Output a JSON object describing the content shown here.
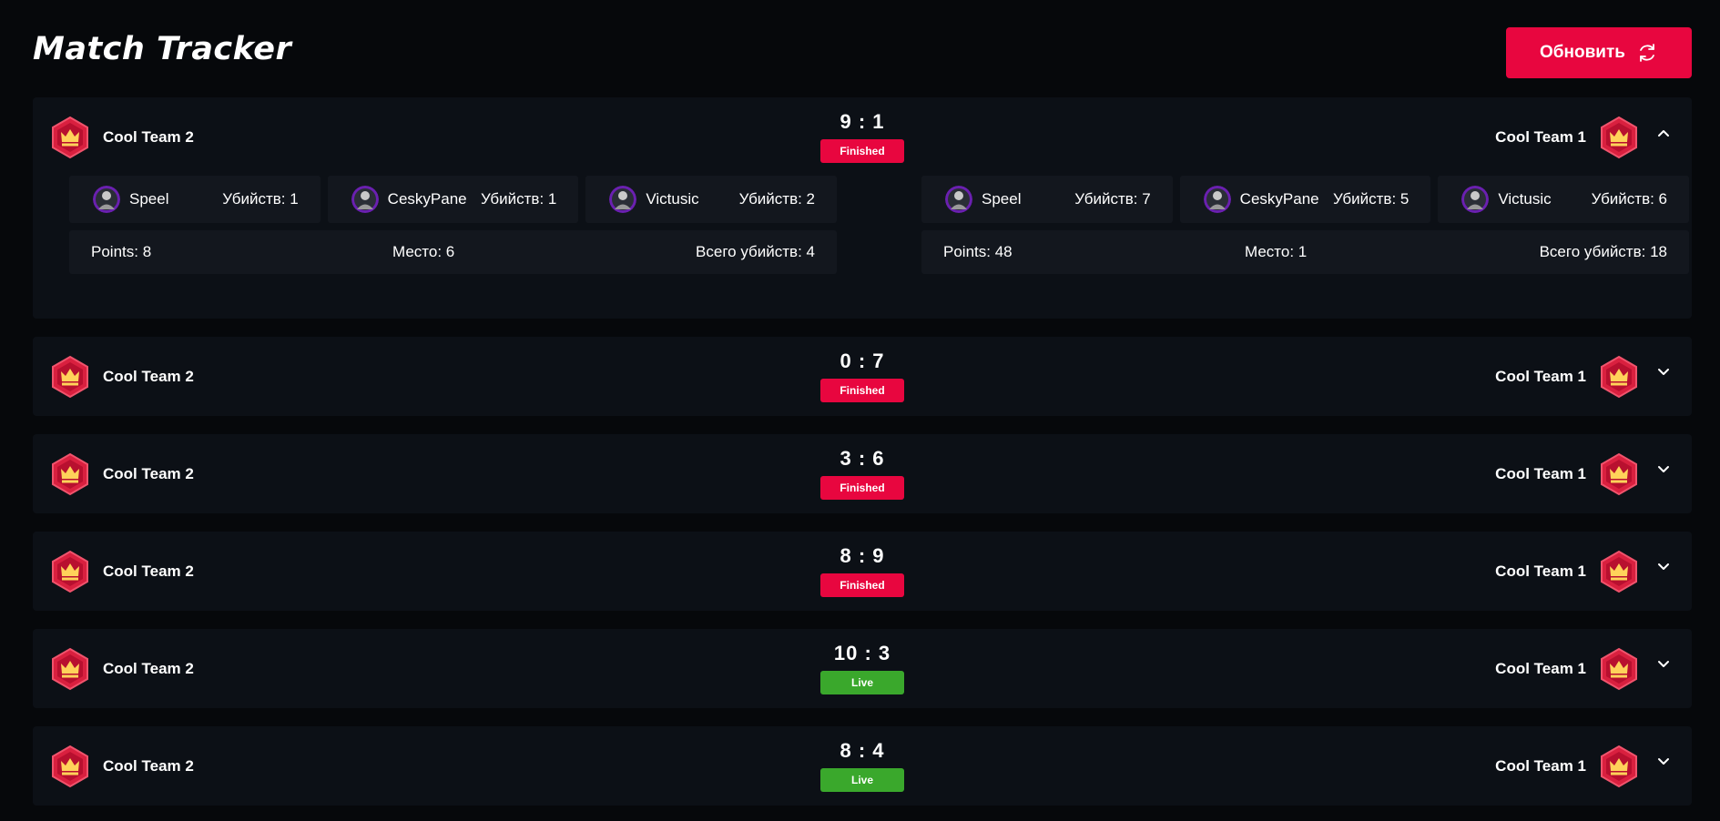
{
  "app": {
    "title": "Match Tracker"
  },
  "toolbar": {
    "refresh_label": "Обновить"
  },
  "colors": {
    "accent": "#e8063f",
    "live": "#3aa82c",
    "card": "#0c1016",
    "panel": "#13171e"
  },
  "matches": [
    {
      "team_left": "Cool Team 2",
      "team_right": "Cool Team 1",
      "score": "9 : 1",
      "status": "Finished",
      "expanded": true,
      "left": {
        "players": [
          {
            "name": "Speel",
            "kills": "Убийств: 1"
          },
          {
            "name": "CeskyPane",
            "kills": "Убийств: 1"
          },
          {
            "name": "Victusic",
            "kills": "Убийств: 2"
          }
        ],
        "points": "Points: 8",
        "place": "Место: 6",
        "total": "Всего убийств: 4"
      },
      "right": {
        "players": [
          {
            "name": "Speel",
            "kills": "Убийств: 7"
          },
          {
            "name": "CeskyPane",
            "kills": "Убийств: 5"
          },
          {
            "name": "Victusic",
            "kills": "Убийств: 6"
          }
        ],
        "points": "Points: 48",
        "place": "Место: 1",
        "total": "Всего убийств: 18"
      }
    },
    {
      "team_left": "Cool Team 2",
      "team_right": "Cool Team 1",
      "score": "0 : 7",
      "status": "Finished"
    },
    {
      "team_left": "Cool Team 2",
      "team_right": "Cool Team 1",
      "score": "3 : 6",
      "status": "Finished"
    },
    {
      "team_left": "Cool Team 2",
      "team_right": "Cool Team 1",
      "score": "8 : 9",
      "status": "Finished"
    },
    {
      "team_left": "Cool Team 2",
      "team_right": "Cool Team 1",
      "score": "10 : 3",
      "status": "Live"
    },
    {
      "team_left": "Cool Team 2",
      "team_right": "Cool Team 1",
      "score": "8 : 4",
      "status": "Live"
    }
  ]
}
